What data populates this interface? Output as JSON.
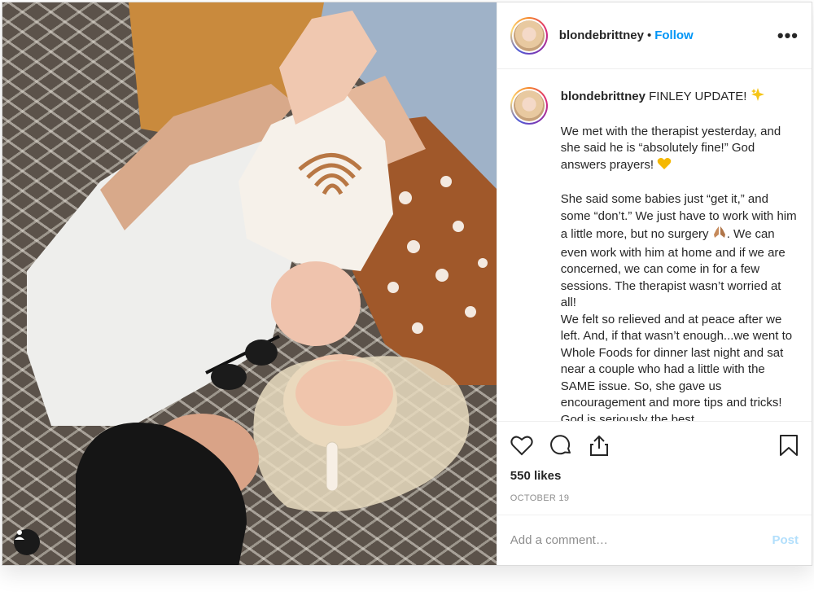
{
  "post": {
    "username": "blondebrittney",
    "separator": "•",
    "follow_label": "Follow",
    "more_label": "•••"
  },
  "caption": {
    "username": "blondebrittney",
    "lead": "FINLEY UPDATE!",
    "para1": "We met with the therapist yesterday, and she said he is “absolutely fine!” God answers prayers!",
    "para2_a": "She said some babies just “get it,” and some “don’t.” We just have to work with him a little more, but no surgery",
    "para2_b": ". We can even work with him at home and if we are concerned, we can come in for a few sessions. The therapist wasn’t worried at all!",
    "para3": "We felt so relieved and at peace after we left. And, if that wasn’t enough...we went to Whole Foods for dinner last night and sat near a couple who had a little with the SAME issue. So, she gave us encouragement and more tips and tricks! God is seriously the best."
  },
  "icons": {
    "like": "heart-icon",
    "comment": "comment-icon",
    "share": "share-icon",
    "save": "bookmark-icon",
    "more": "more-options-icon",
    "user_tag": "user-tag-icon",
    "sparkle": "sparkles-emoji",
    "heart_emoji": "yellow-heart-emoji",
    "pray": "praying-hands-emoji"
  },
  "stats": {
    "likes": "550 likes",
    "date": "OCTOBER 19"
  },
  "comment": {
    "placeholder": "Add a comment…",
    "post_label": "Post"
  },
  "colors": {
    "link_blue": "#0095f6",
    "post_disabled": "#b2dffc",
    "text": "#262626",
    "muted": "#8e8e8e",
    "border": "#dbdbdb"
  }
}
